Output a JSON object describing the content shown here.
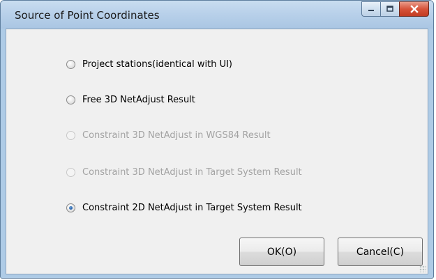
{
  "window": {
    "title": "Source of Point Coordinates",
    "caption_buttons": [
      "minimize",
      "maximize",
      "close"
    ]
  },
  "options": [
    {
      "label": "Project stations(identical with UI)",
      "checked": false,
      "enabled": true
    },
    {
      "label": "Free 3D NetAdjust Result",
      "checked": false,
      "enabled": true
    },
    {
      "label": "Constraint 3D NetAdjust in WGS84 Result",
      "checked": false,
      "enabled": false
    },
    {
      "label": "Constraint 3D NetAdjust in Target System Result",
      "checked": false,
      "enabled": false
    },
    {
      "label": "Constraint 2D NetAdjust in Target System Result",
      "checked": true,
      "enabled": true
    }
  ],
  "buttons": {
    "ok_label": "OK(O)",
    "cancel_label": "Cancel(C)"
  },
  "colors": {
    "titlebar": "#b9d1ea",
    "client_bg": "#f0f0f0",
    "disabled_text": "#a3a3a3",
    "close_red": "#d6533a"
  }
}
